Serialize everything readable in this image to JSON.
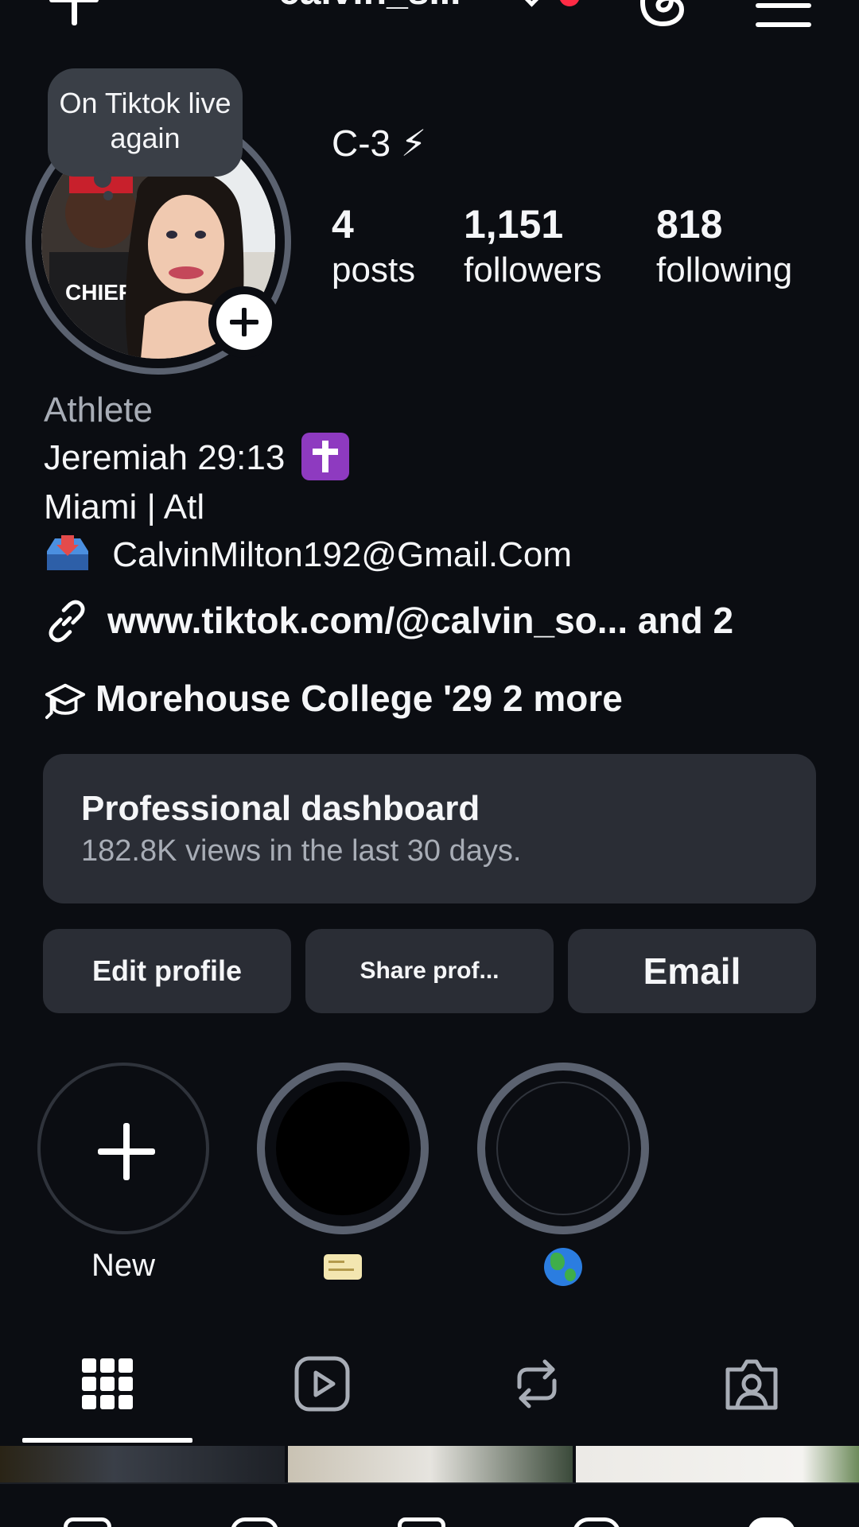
{
  "header": {
    "username": "calvin_s...",
    "has_notification_dot": true
  },
  "profile": {
    "note": "On Tiktok live again",
    "display_name": "C-3 ⚡",
    "stats": {
      "posts": {
        "count": "4",
        "label": "posts"
      },
      "followers": {
        "count": "1,151",
        "label": "followers"
      },
      "following": {
        "count": "818",
        "label": "following"
      }
    }
  },
  "bio": {
    "category": "Athlete",
    "line1": "Jeremiah 29:13",
    "line2": "Miami | Atl",
    "email": "CalvinMilton192@Gmail.Com",
    "link": "www.tiktok.com/@calvin_so...  and 2",
    "education": "Morehouse College '29  2 more"
  },
  "dashboard": {
    "title": "Professional dashboard",
    "subtitle": "182.8K views in the last 30 days."
  },
  "actions": {
    "edit": "Edit profile",
    "share": "Share prof...",
    "email": "Email"
  },
  "highlights": [
    {
      "label": "New"
    },
    {
      "label": ""
    },
    {
      "label": ""
    }
  ],
  "tabs": [
    "posts-grid",
    "reels",
    "reposts",
    "tagged"
  ],
  "colors": {
    "background": "#0b0d12",
    "surface": "#2a2d35",
    "ring": "#5b6270",
    "notification": "#ff2b45",
    "secondary_text": "#a8adb6"
  }
}
